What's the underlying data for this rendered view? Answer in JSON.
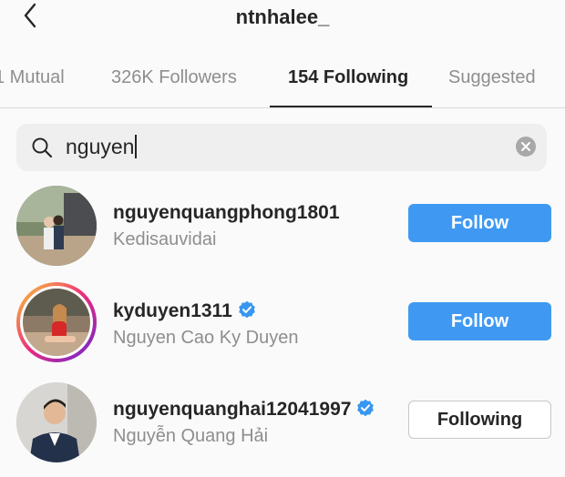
{
  "header": {
    "title": "ntnhalee_"
  },
  "tabs": [
    {
      "label": "1 Mutual"
    },
    {
      "label": "326K Followers"
    },
    {
      "label": "154 Following"
    },
    {
      "label": "Suggested"
    }
  ],
  "search": {
    "value": "nguyen"
  },
  "users": [
    {
      "username": "nguyenquangphong1801",
      "fullname": "Kedisauvidai",
      "verified": false,
      "button": "Follow"
    },
    {
      "username": "kyduyen1311",
      "fullname": "Nguyen Cao Ky Duyen",
      "verified": true,
      "button": "Follow"
    },
    {
      "username": "nguyenquanghai12041997",
      "fullname": "Nguyễn Quang Hải",
      "verified": true,
      "button": "Following"
    }
  ],
  "colors": {
    "accent": "#3f99f2",
    "verified": "#3897f0",
    "muted": "#8e8e8e"
  },
  "icons": [
    "back-arrow-icon",
    "search-icon",
    "clear-icon",
    "verified-icon"
  ]
}
